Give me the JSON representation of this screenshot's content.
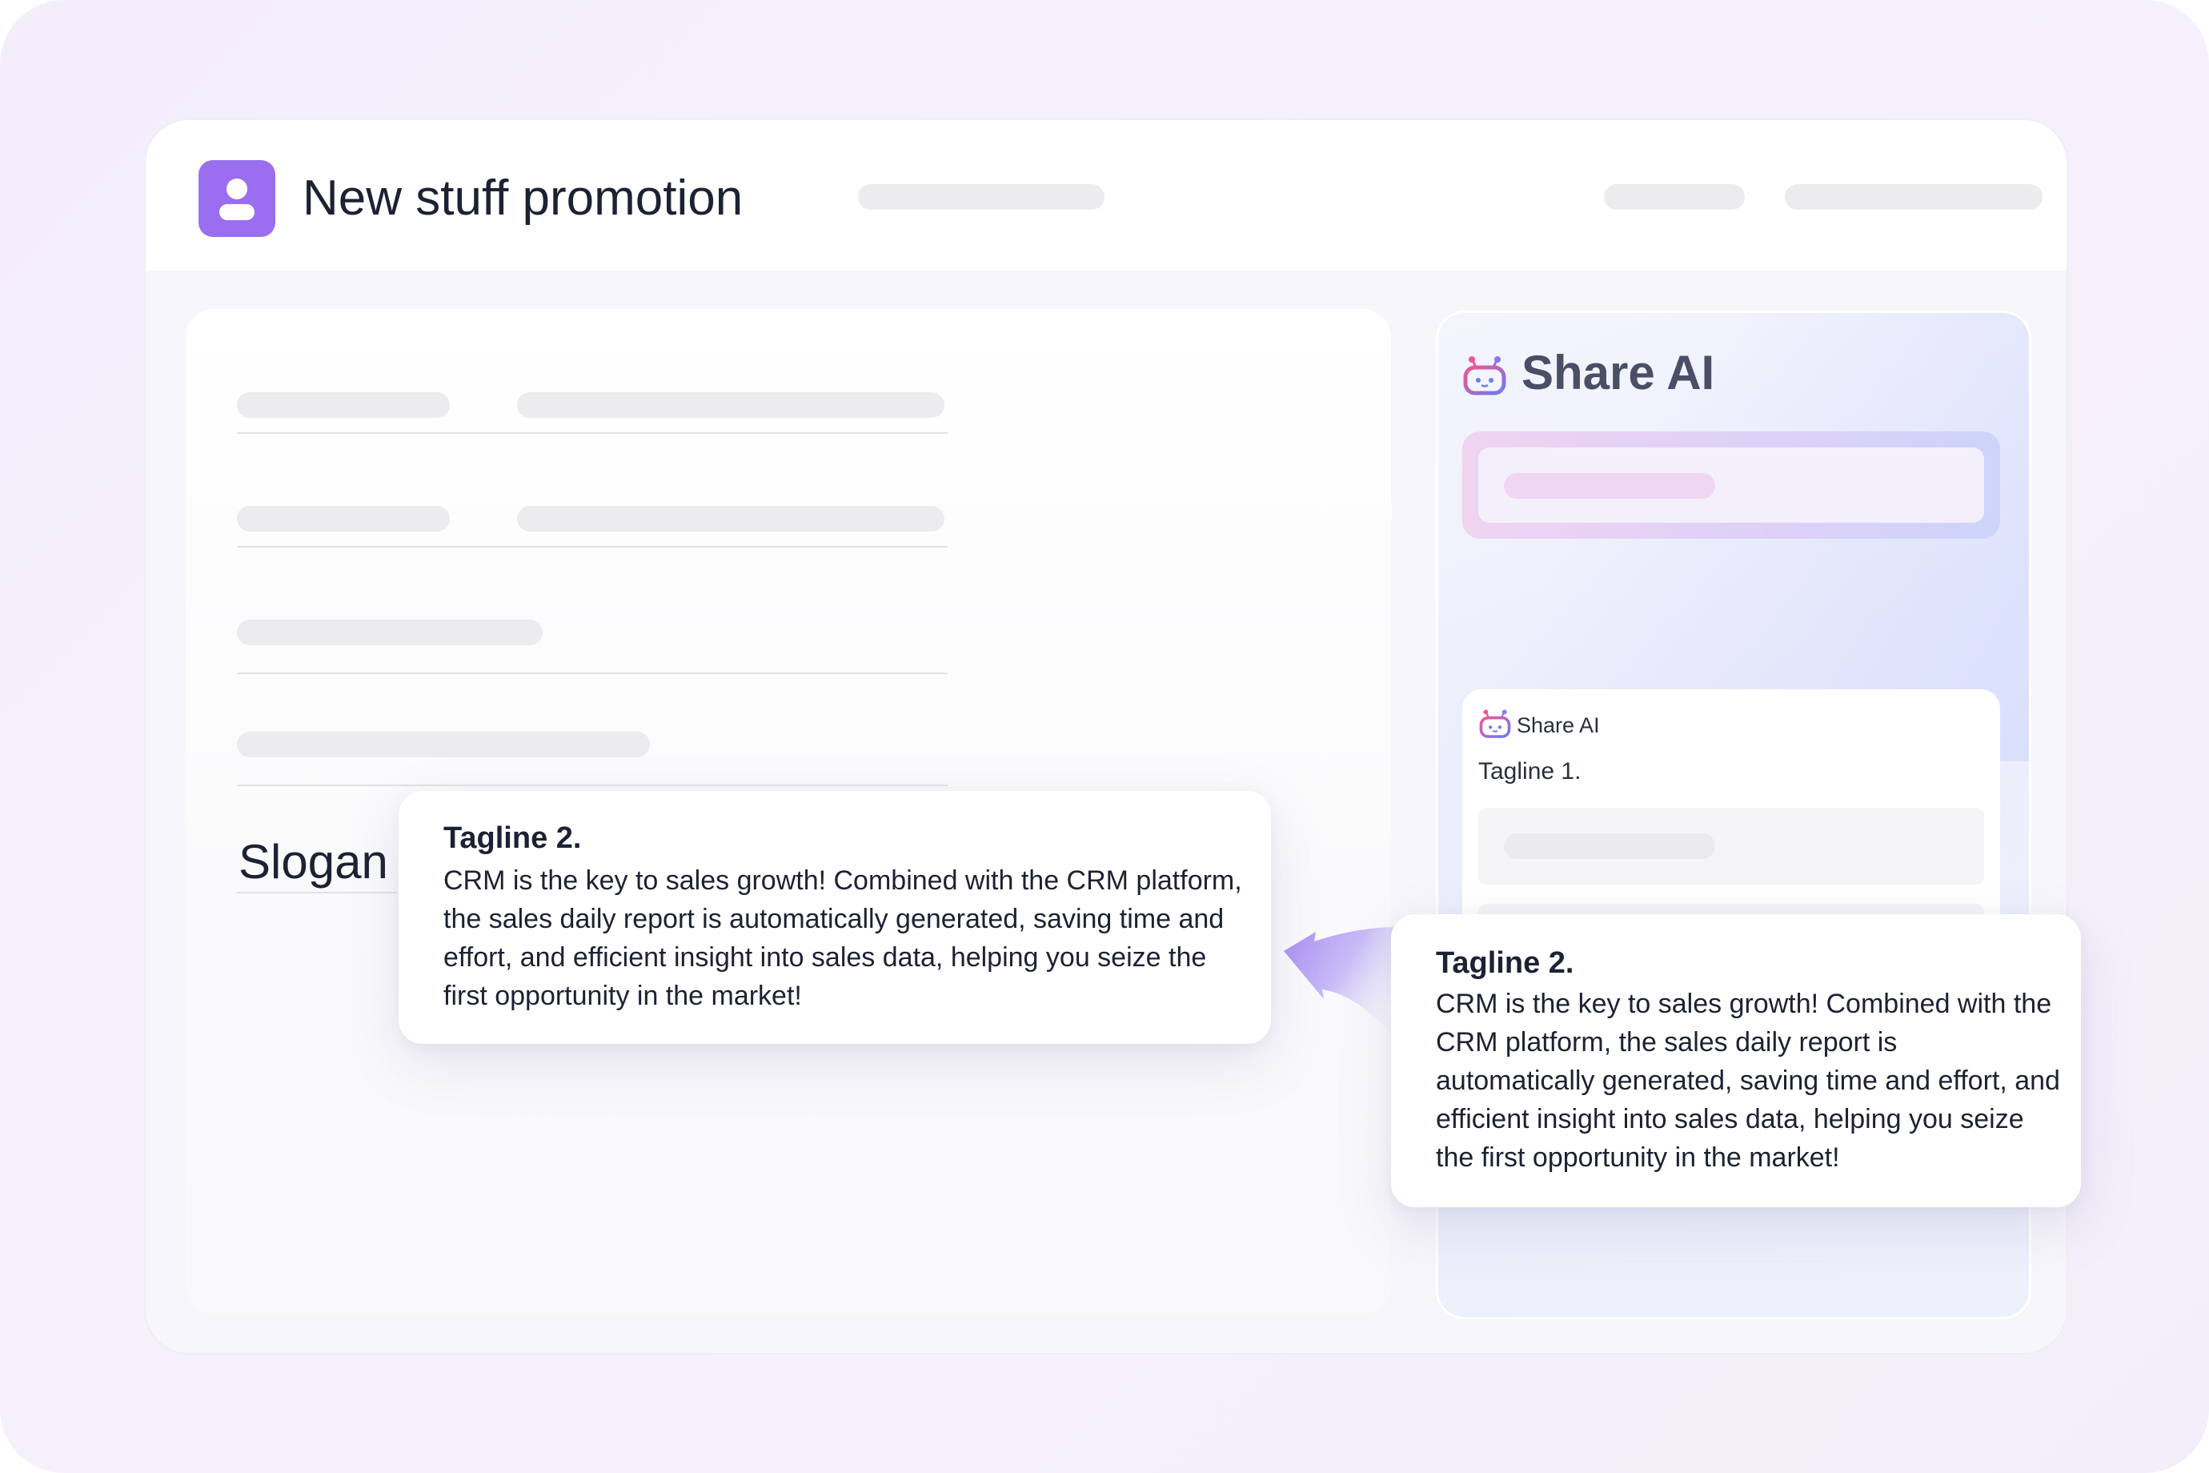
{
  "header": {
    "title": "New stuff promotion",
    "icon": "user-icon"
  },
  "form": {
    "slogan_label": "Slogan"
  },
  "share_ai": {
    "title": "Share AI",
    "icon": "robot-icon",
    "chat": {
      "sender": "Share AI",
      "message": "Tagline 1."
    }
  },
  "popup_left": {
    "title": "Tagline 2.",
    "body": "CRM is the key to sales growth! Combined with the CRM platform, the sales daily report is automatically generated, saving time and effort, and efficient insight into sales data, helping you seize the first opportunity in the market!"
  },
  "popup_right": {
    "title": "Tagline 2.",
    "body": "CRM is the key to sales growth! Combined with the CRM platform, the sales daily report is automatically generated, saving time and effort, and efficient insight into sales data, helping you seize the first opportunity in the market!"
  },
  "colors": {
    "accent": "#9b6ef0",
    "placeholder": "#ececee",
    "text": "#1c2233"
  }
}
